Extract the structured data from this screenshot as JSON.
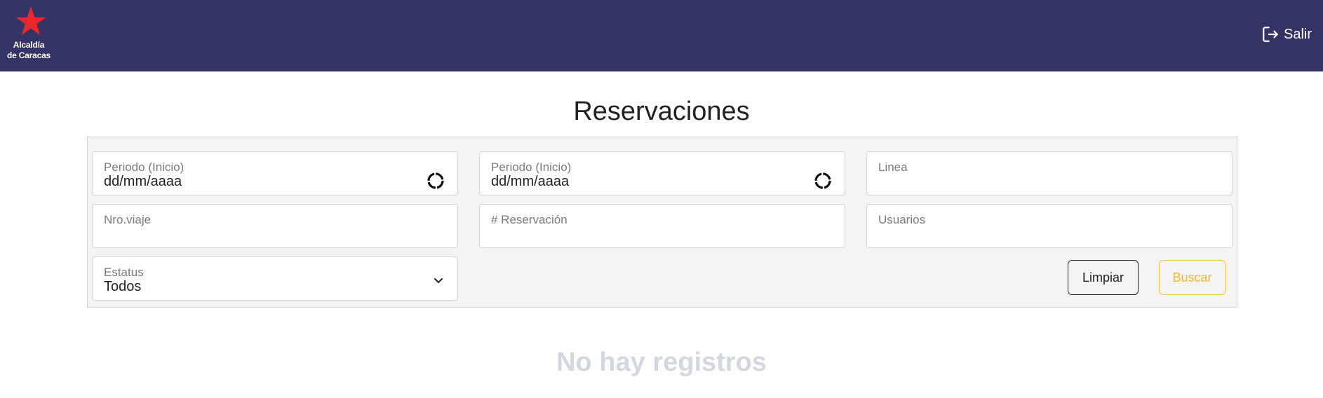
{
  "header": {
    "logo_line1": "Alcaldía",
    "logo_line2": "de Caracas",
    "logout_label": "Salir"
  },
  "page_title": "Reservaciones",
  "filters": {
    "start_date": {
      "label": "Periodo (Inicio)",
      "value": "dd/mm/aaaa"
    },
    "end_date": {
      "label": "Periodo (Inicio)",
      "value": "dd/mm/aaaa"
    },
    "line": {
      "label": "Linea"
    },
    "trip_number": {
      "label": "Nro.viaje"
    },
    "reservation_number": {
      "label": "# Reservación"
    },
    "users": {
      "label": "Usuarios"
    },
    "status": {
      "label": "Estatus",
      "value": "Todos"
    }
  },
  "buttons": {
    "clear": "Limpiar",
    "search": "Buscar"
  },
  "empty_message": "No hay registros",
  "colors": {
    "header_bg": "#333366",
    "logo_star": "#e8282b",
    "search_accent": "#f5b731",
    "empty_text": "#d3d8e0"
  },
  "icons": {
    "logo": "red-star-icon",
    "logout": "logout-icon",
    "date": "calendar-icon",
    "dropdown": "chevron-down-icon"
  }
}
